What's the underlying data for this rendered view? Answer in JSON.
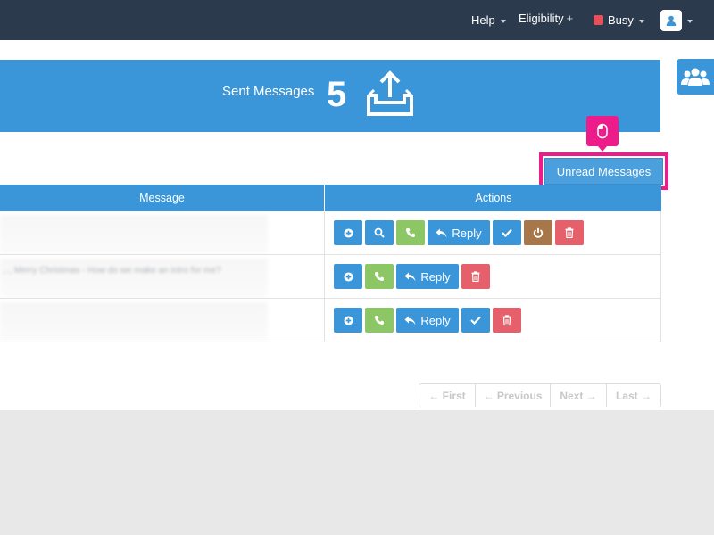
{
  "nav": {
    "help_label": "Help",
    "eligibility_label": "Eligibility",
    "eligibility_plus": "+",
    "status_label": "Busy",
    "status_color": "#e5505b"
  },
  "banner": {
    "title": "Sent Messages",
    "count": "5",
    "icon": "outbox-upload-icon"
  },
  "side_tab": {
    "icon": "users-group-icon"
  },
  "tooltip": {
    "icon": "mouse-icon"
  },
  "unread_button": {
    "label": "Unread Messages"
  },
  "table": {
    "headers": {
      "message": "Message",
      "actions": "Actions"
    },
    "rows": [
      {
        "message": "",
        "actions": [
          "add",
          "view",
          "call",
          "reply",
          "done",
          "power",
          "delete"
        ]
      },
      {
        "message": "..., Merry Christmas - How do we make an intro for me?",
        "actions": [
          "add",
          "call",
          "reply",
          "delete"
        ]
      },
      {
        "message": "",
        "actions": [
          "add",
          "call",
          "reply",
          "done",
          "delete"
        ]
      }
    ],
    "reply_label": "Reply"
  },
  "pagination": {
    "first": "← First",
    "previous": "← Previous",
    "next": "Next →",
    "last": "Last →"
  },
  "colors": {
    "topbar": "#2b3a4c",
    "primary": "#3a96d8",
    "success": "#8dc765",
    "warning": "#a7774a",
    "danger": "#e5606a",
    "highlight": "#ee1c8a"
  }
}
